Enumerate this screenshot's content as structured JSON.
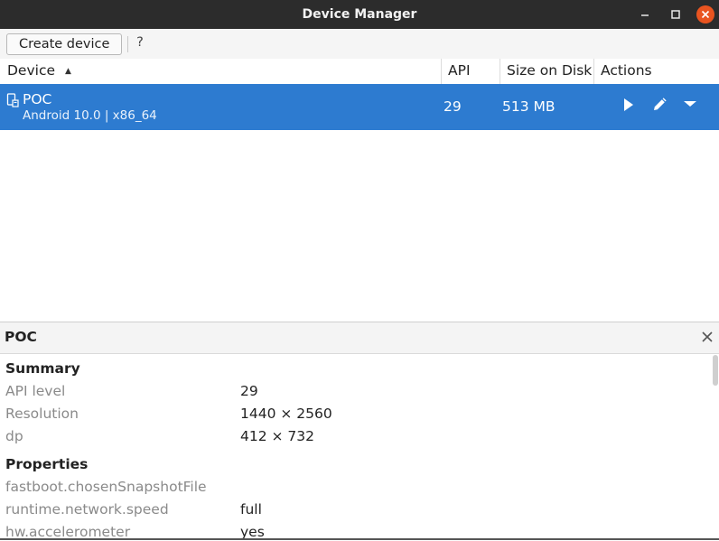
{
  "window": {
    "title": "Device Manager",
    "min_icon": "minimize-icon",
    "max_icon": "maximize-icon",
    "close_icon": "close-icon",
    "close_color": "#e95420"
  },
  "toolbar": {
    "create_label": "Create device",
    "help_label": "?"
  },
  "table": {
    "columns": {
      "device": "Device",
      "api": "API",
      "size": "Size on Disk",
      "actions": "Actions"
    },
    "sort": "ascending",
    "rows": [
      {
        "name": "POC",
        "subtitle": "Android 10.0 | x86_64",
        "api": "29",
        "size": "513 MB",
        "selected": true,
        "actions": [
          "play-icon",
          "edit-icon",
          "dropdown-icon"
        ]
      }
    ],
    "selected_color": "#2d7bd0"
  },
  "details": {
    "title": "POC",
    "summary": {
      "heading": "Summary",
      "items": [
        {
          "key": "API level",
          "value": "29"
        },
        {
          "key": "Resolution",
          "value": "1440 × 2560"
        },
        {
          "key": "dp",
          "value": "412 × 732"
        }
      ]
    },
    "properties": {
      "heading": "Properties",
      "items": [
        {
          "key": "fastboot.chosenSnapshotFile",
          "value": ""
        },
        {
          "key": "runtime.network.speed",
          "value": "full"
        },
        {
          "key": "hw.accelerometer",
          "value": "yes"
        }
      ]
    }
  }
}
